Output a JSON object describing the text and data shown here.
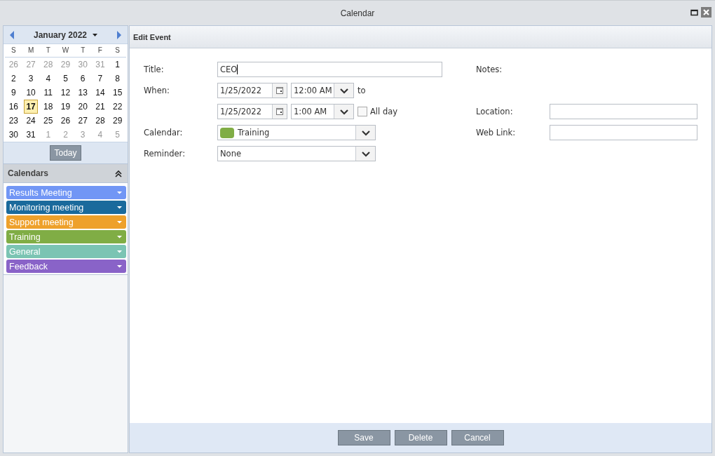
{
  "window": {
    "title": "Calendar"
  },
  "mini_calendar": {
    "month": "January 2022",
    "weekdays": [
      "S",
      "M",
      "T",
      "W",
      "T",
      "F",
      "S"
    ],
    "weeks": [
      [
        {
          "day": "26",
          "muted": true,
          "selected": false
        },
        {
          "day": "27",
          "muted": true,
          "selected": false
        },
        {
          "day": "28",
          "muted": true,
          "selected": false
        },
        {
          "day": "29",
          "muted": true,
          "selected": false
        },
        {
          "day": "30",
          "muted": true,
          "selected": false
        },
        {
          "day": "31",
          "muted": true,
          "selected": false
        },
        {
          "day": "1",
          "muted": false,
          "selected": false
        }
      ],
      [
        {
          "day": "2",
          "muted": false,
          "selected": false
        },
        {
          "day": "3",
          "muted": false,
          "selected": false
        },
        {
          "day": "4",
          "muted": false,
          "selected": false
        },
        {
          "day": "5",
          "muted": false,
          "selected": false
        },
        {
          "day": "6",
          "muted": false,
          "selected": false
        },
        {
          "day": "7",
          "muted": false,
          "selected": false
        },
        {
          "day": "8",
          "muted": false,
          "selected": false
        }
      ],
      [
        {
          "day": "9",
          "muted": false,
          "selected": false
        },
        {
          "day": "10",
          "muted": false,
          "selected": false
        },
        {
          "day": "11",
          "muted": false,
          "selected": false
        },
        {
          "day": "12",
          "muted": false,
          "selected": false
        },
        {
          "day": "13",
          "muted": false,
          "selected": false
        },
        {
          "day": "14",
          "muted": false,
          "selected": false
        },
        {
          "day": "15",
          "muted": false,
          "selected": false
        }
      ],
      [
        {
          "day": "16",
          "muted": false,
          "selected": false
        },
        {
          "day": "17",
          "muted": false,
          "selected": true
        },
        {
          "day": "18",
          "muted": false,
          "selected": false
        },
        {
          "day": "19",
          "muted": false,
          "selected": false
        },
        {
          "day": "20",
          "muted": false,
          "selected": false
        },
        {
          "day": "21",
          "muted": false,
          "selected": false
        },
        {
          "day": "22",
          "muted": false,
          "selected": false
        }
      ],
      [
        {
          "day": "23",
          "muted": false,
          "selected": false
        },
        {
          "day": "24",
          "muted": false,
          "selected": false
        },
        {
          "day": "25",
          "muted": false,
          "selected": false
        },
        {
          "day": "26",
          "muted": false,
          "selected": false
        },
        {
          "day": "27",
          "muted": false,
          "selected": false
        },
        {
          "day": "28",
          "muted": false,
          "selected": false
        },
        {
          "day": "29",
          "muted": false,
          "selected": false
        }
      ],
      [
        {
          "day": "30",
          "muted": false,
          "selected": false
        },
        {
          "day": "31",
          "muted": false,
          "selected": false
        },
        {
          "day": "1",
          "muted": true,
          "selected": false
        },
        {
          "day": "2",
          "muted": true,
          "selected": false
        },
        {
          "day": "3",
          "muted": true,
          "selected": false
        },
        {
          "day": "4",
          "muted": true,
          "selected": false
        },
        {
          "day": "5",
          "muted": true,
          "selected": false
        }
      ]
    ],
    "today_button": "Today"
  },
  "calendars": {
    "header": "Calendars",
    "items": [
      {
        "name": "Results Meeting",
        "color": "#7196f5"
      },
      {
        "name": "Monitoring meeting",
        "color": "#1a6a9c"
      },
      {
        "name": "Support meeting",
        "color": "#eea12b"
      },
      {
        "name": "Training",
        "color": "#80ad45"
      },
      {
        "name": "General",
        "color": "#7bc4b3"
      },
      {
        "name": "Feedback",
        "color": "#8963c8"
      }
    ]
  },
  "edit_event": {
    "header": "Edit Event",
    "title_label": "Title:",
    "title_value": "CEO",
    "when_label": "When:",
    "start": {
      "date": "1/25/2022",
      "time": "12:00 AM"
    },
    "to_label": "to",
    "end": {
      "date": "1/25/2022",
      "time": "1:00 AM"
    },
    "all_day": {
      "label": "All day",
      "checked": false
    },
    "calendar_label": "Calendar:",
    "calendar": {
      "value": "Training",
      "color": "#80ad45"
    },
    "reminder_label": "Reminder:",
    "reminder_value": "None",
    "notes_label": "Notes:",
    "location_label": "Location:",
    "web_link_label": "Web Link:"
  },
  "buttons": [
    "Save",
    "Delete",
    "Cancel"
  ]
}
